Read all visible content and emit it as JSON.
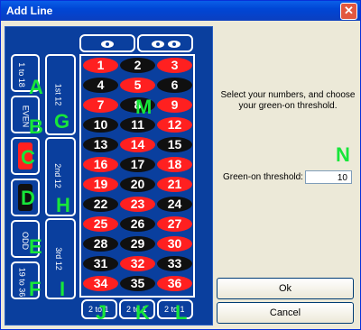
{
  "window": {
    "title": "Add Line",
    "close_glyph": "✕"
  },
  "board": {
    "numbers": [
      {
        "n": "1",
        "c": "red"
      },
      {
        "n": "2",
        "c": "black"
      },
      {
        "n": "3",
        "c": "red"
      },
      {
        "n": "4",
        "c": "black"
      },
      {
        "n": "5",
        "c": "red"
      },
      {
        "n": "6",
        "c": "black"
      },
      {
        "n": "7",
        "c": "red"
      },
      {
        "n": "8",
        "c": "black"
      },
      {
        "n": "9",
        "c": "red"
      },
      {
        "n": "10",
        "c": "black"
      },
      {
        "n": "11",
        "c": "black"
      },
      {
        "n": "12",
        "c": "red"
      },
      {
        "n": "13",
        "c": "black"
      },
      {
        "n": "14",
        "c": "red"
      },
      {
        "n": "15",
        "c": "black"
      },
      {
        "n": "16",
        "c": "red"
      },
      {
        "n": "17",
        "c": "black"
      },
      {
        "n": "18",
        "c": "red"
      },
      {
        "n": "19",
        "c": "red"
      },
      {
        "n": "20",
        "c": "black"
      },
      {
        "n": "21",
        "c": "red"
      },
      {
        "n": "22",
        "c": "black"
      },
      {
        "n": "23",
        "c": "red"
      },
      {
        "n": "24",
        "c": "black"
      },
      {
        "n": "25",
        "c": "red"
      },
      {
        "n": "26",
        "c": "black"
      },
      {
        "n": "27",
        "c": "red"
      },
      {
        "n": "28",
        "c": "black"
      },
      {
        "n": "29",
        "c": "black"
      },
      {
        "n": "30",
        "c": "red"
      },
      {
        "n": "31",
        "c": "black"
      },
      {
        "n": "32",
        "c": "red"
      },
      {
        "n": "33",
        "c": "black"
      },
      {
        "n": "34",
        "c": "red"
      },
      {
        "n": "35",
        "c": "black"
      },
      {
        "n": "36",
        "c": "red"
      }
    ],
    "dozens": [
      "1st 12",
      "2nd 12",
      "3rd 12"
    ],
    "outside_labels": [
      "1 to 18",
      "EVEN",
      "ODD",
      "19 to 36"
    ],
    "column_labels": [
      "2 to 1",
      "2 to 1",
      "2 to 1"
    ],
    "overlay_letters": {
      "A": "A",
      "B": "B",
      "C": "C",
      "D": "D",
      "E": "E",
      "F": "F",
      "G": "G",
      "H": "H",
      "I": "I",
      "J": "J",
      "K": "K",
      "L": "L",
      "M": "M",
      "N": "N"
    }
  },
  "panel": {
    "instructions": "Select your numbers, and choose your green-on threshold.",
    "threshold_label": "Green-on threshold:",
    "threshold_value": "10",
    "ok_label": "Ok",
    "cancel_label": "Cancel"
  },
  "colors": {
    "board_blue": "#0a3f9e",
    "red": "#ff2020",
    "black": "#101010",
    "overlay_green": "#17e63a"
  }
}
